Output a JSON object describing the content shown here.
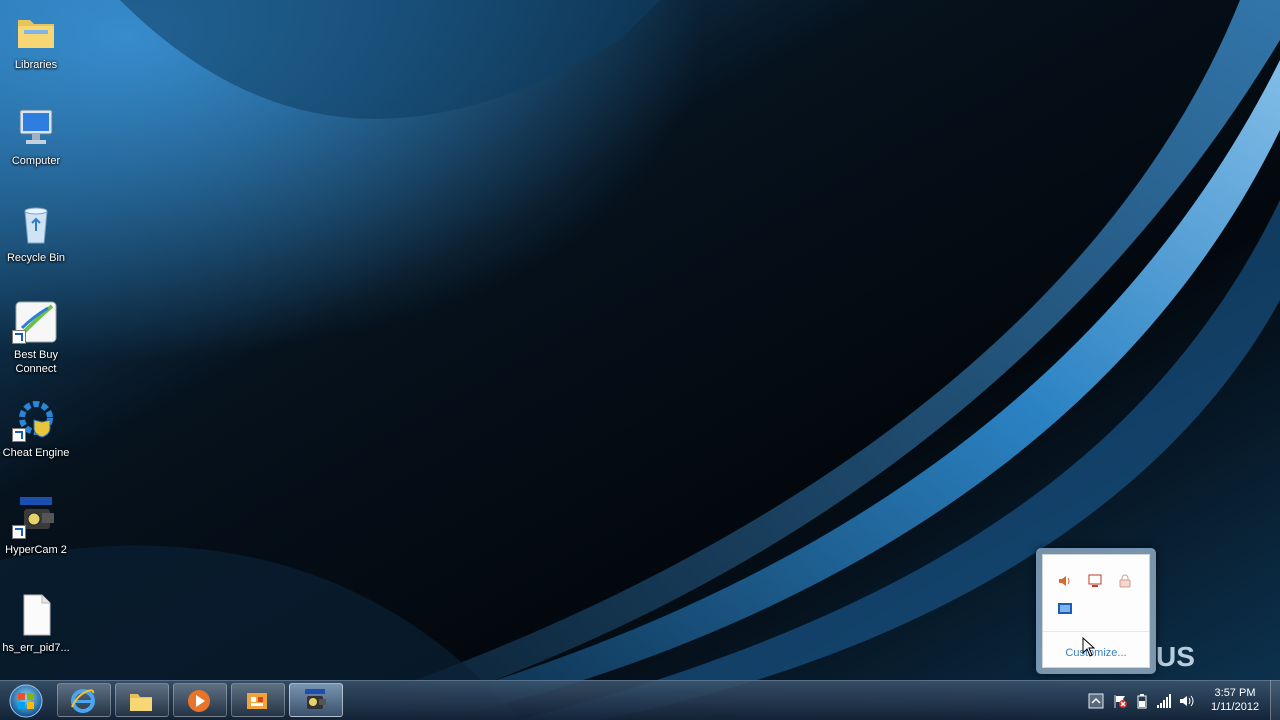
{
  "desktop": {
    "icons": [
      {
        "label": "Libraries",
        "icon": "libraries-folder-icon"
      },
      {
        "label": "Computer",
        "icon": "computer-monitor-icon"
      },
      {
        "label": "Recycle Bin",
        "icon": "recycle-bin-icon"
      },
      {
        "label": "Best Buy Connect",
        "icon": "best-buy-connect-icon"
      },
      {
        "label": "Cheat Engine",
        "icon": "cheat-engine-icon"
      },
      {
        "label": "HyperCam 2",
        "icon": "hypercam-icon"
      },
      {
        "label": "hs_err_pid7...",
        "icon": "text-file-icon"
      }
    ],
    "brand_logo_text": "US"
  },
  "taskbar": {
    "pinned": [
      {
        "icon": "internet-explorer-icon"
      },
      {
        "icon": "windows-explorer-folder-icon"
      },
      {
        "icon": "media-player-icon"
      },
      {
        "icon": "paint-icon"
      },
      {
        "icon": "hypercam-icon"
      }
    ],
    "clock": {
      "time": "3:57 PM",
      "date": "1/11/2012"
    }
  },
  "overflow_popup": {
    "customize_label": "Customize...",
    "icons": [
      "speaker-icon",
      "display-icon",
      "lock-icon",
      "network-adapter-icon"
    ]
  },
  "colors": {
    "wallpaper_base": "#000000",
    "wallpaper_accent": "#2a8fd8",
    "link_blue": "#3b7fc4"
  }
}
